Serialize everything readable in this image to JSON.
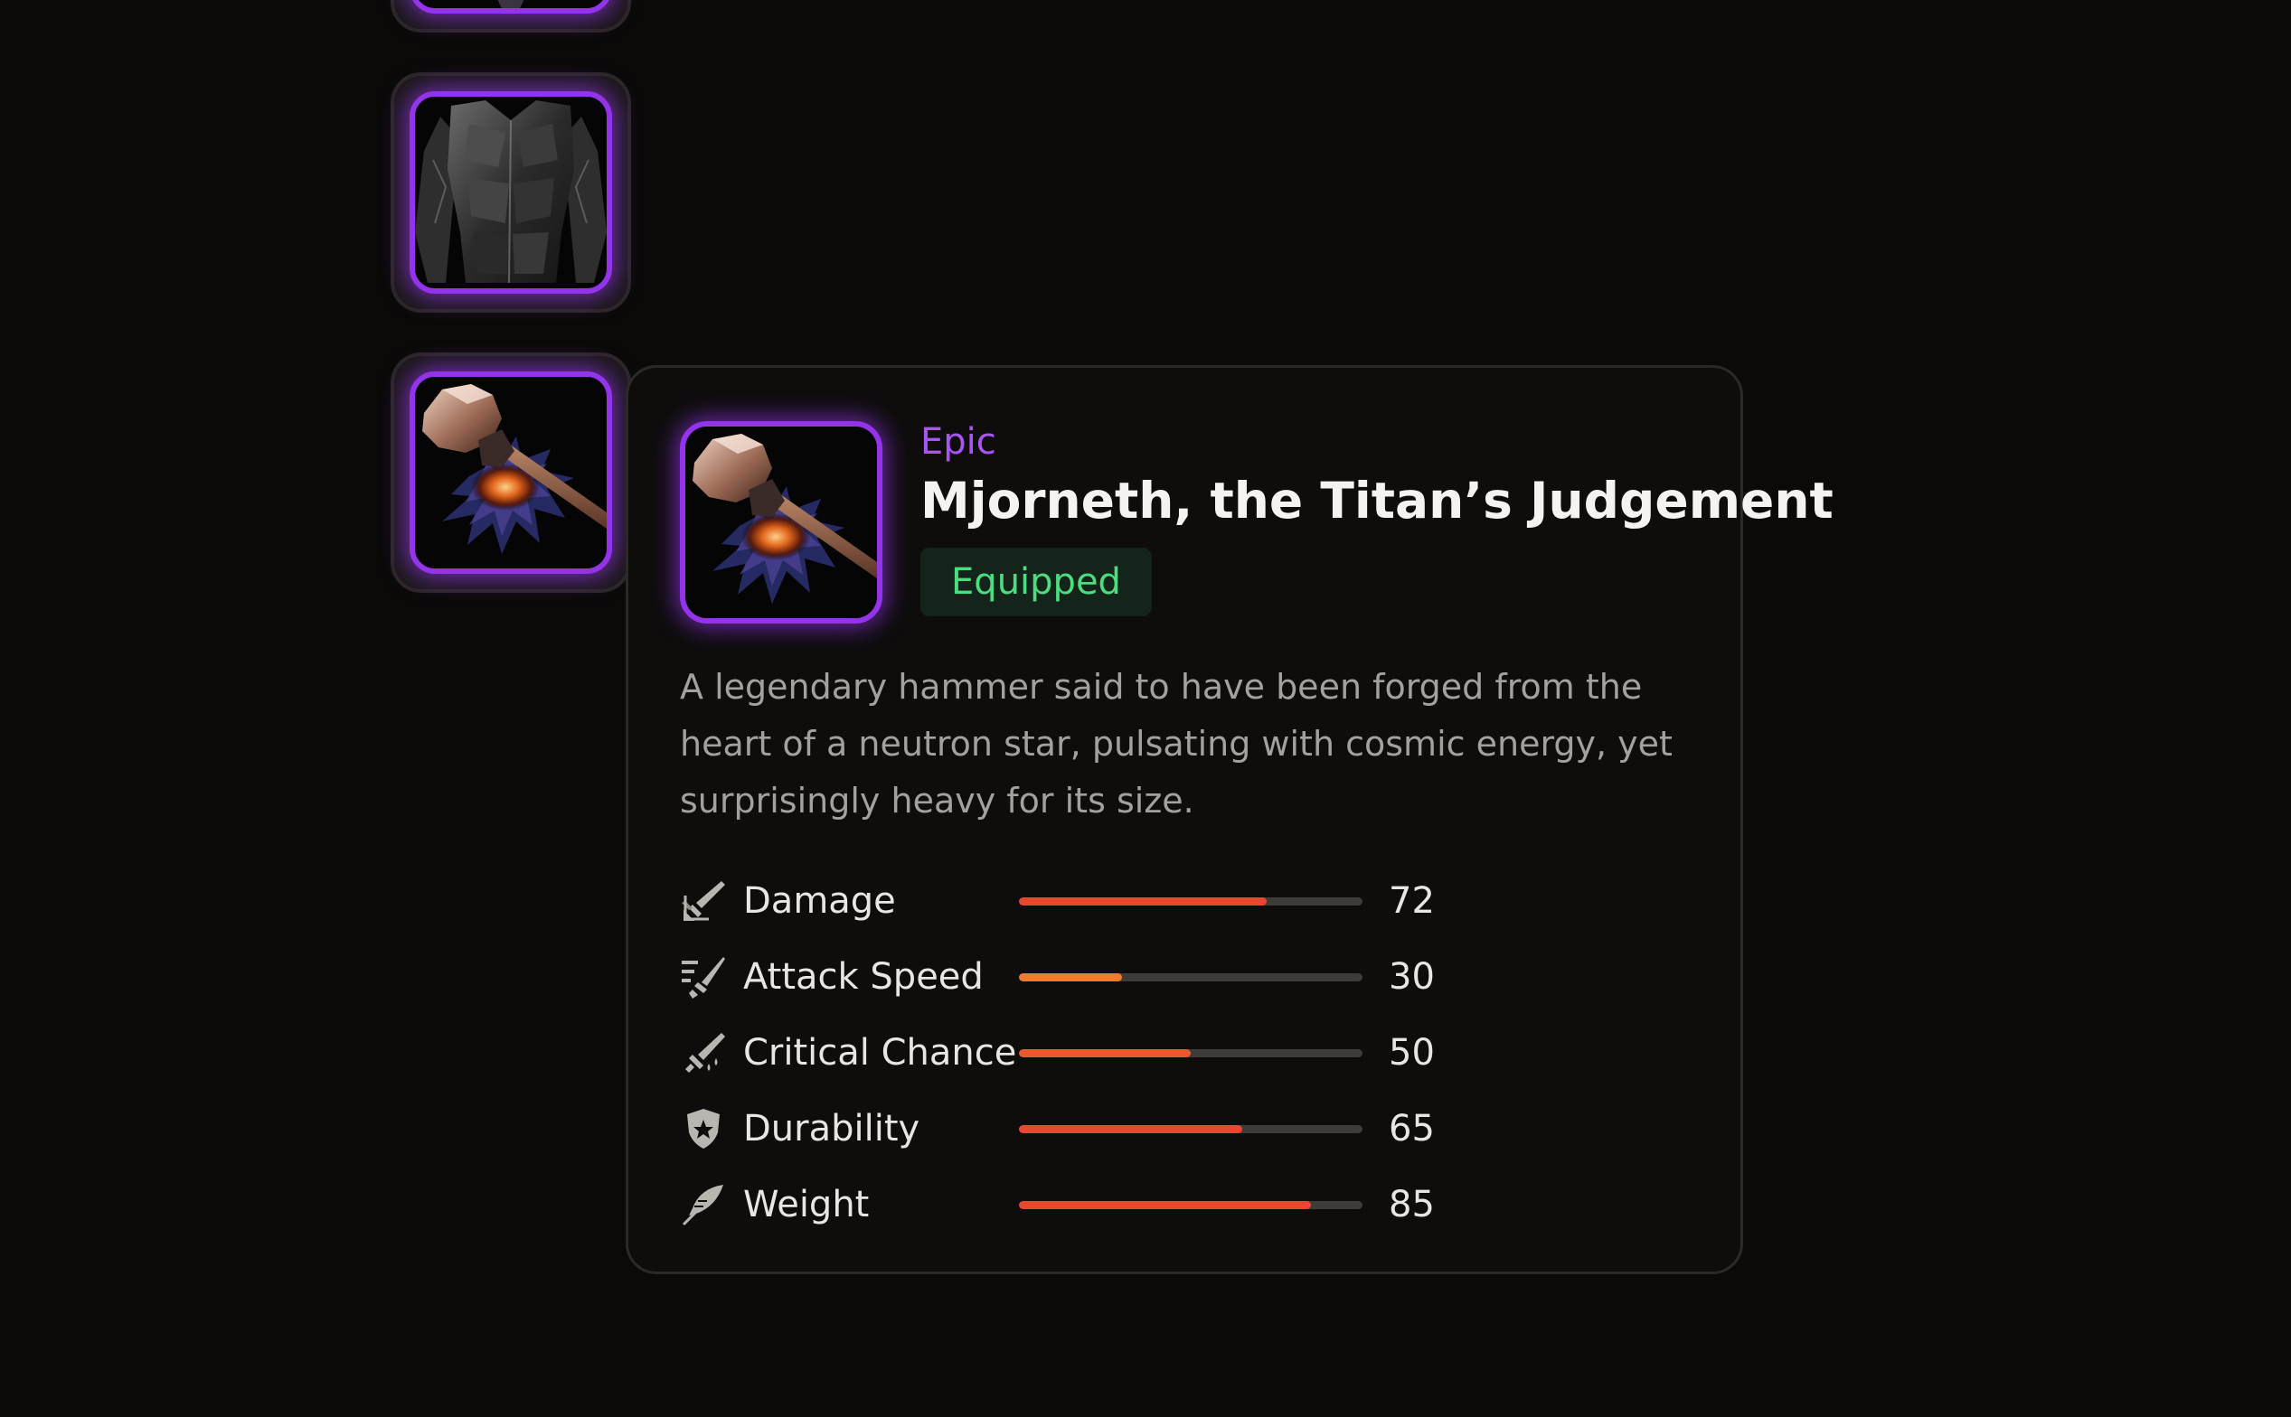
{
  "inventory": {
    "slots": [
      {
        "name": "top-item",
        "rarity": "Epic"
      },
      {
        "name": "obsidian-chest-armor",
        "rarity": "Epic"
      },
      {
        "name": "hammer-weapon",
        "rarity": "Epic",
        "selected": true
      }
    ],
    "rarity_color": "#9333ea"
  },
  "tooltip": {
    "rarity": "Epic",
    "name": "Mjorneth, the Titan’s Judgement",
    "status": "Equipped",
    "description": "A legendary hammer said to have been forged from the heart of a neutron star, pulsating with cosmic energy, yet surprisingly heavy for its size.",
    "colors": {
      "rarity": "#a855f7",
      "status": "#4ade80"
    },
    "stats": [
      {
        "label": "Damage",
        "value": "72",
        "percent": 72,
        "color": "#e8482f",
        "icon": "sword-icon"
      },
      {
        "label": "Attack Speed",
        "value": "30",
        "percent": 30,
        "color": "#ec7c30",
        "icon": "swift-sword-icon"
      },
      {
        "label": "Critical Chance",
        "value": "50",
        "percent": 50,
        "color": "#e85a2c",
        "icon": "bleeding-blade-icon"
      },
      {
        "label": "Durability",
        "value": "65",
        "percent": 65,
        "color": "#e8482f",
        "icon": "shield-icon"
      },
      {
        "label": "Weight",
        "value": "85",
        "percent": 85,
        "color": "#e8482f",
        "icon": "feather-icon"
      }
    ]
  }
}
